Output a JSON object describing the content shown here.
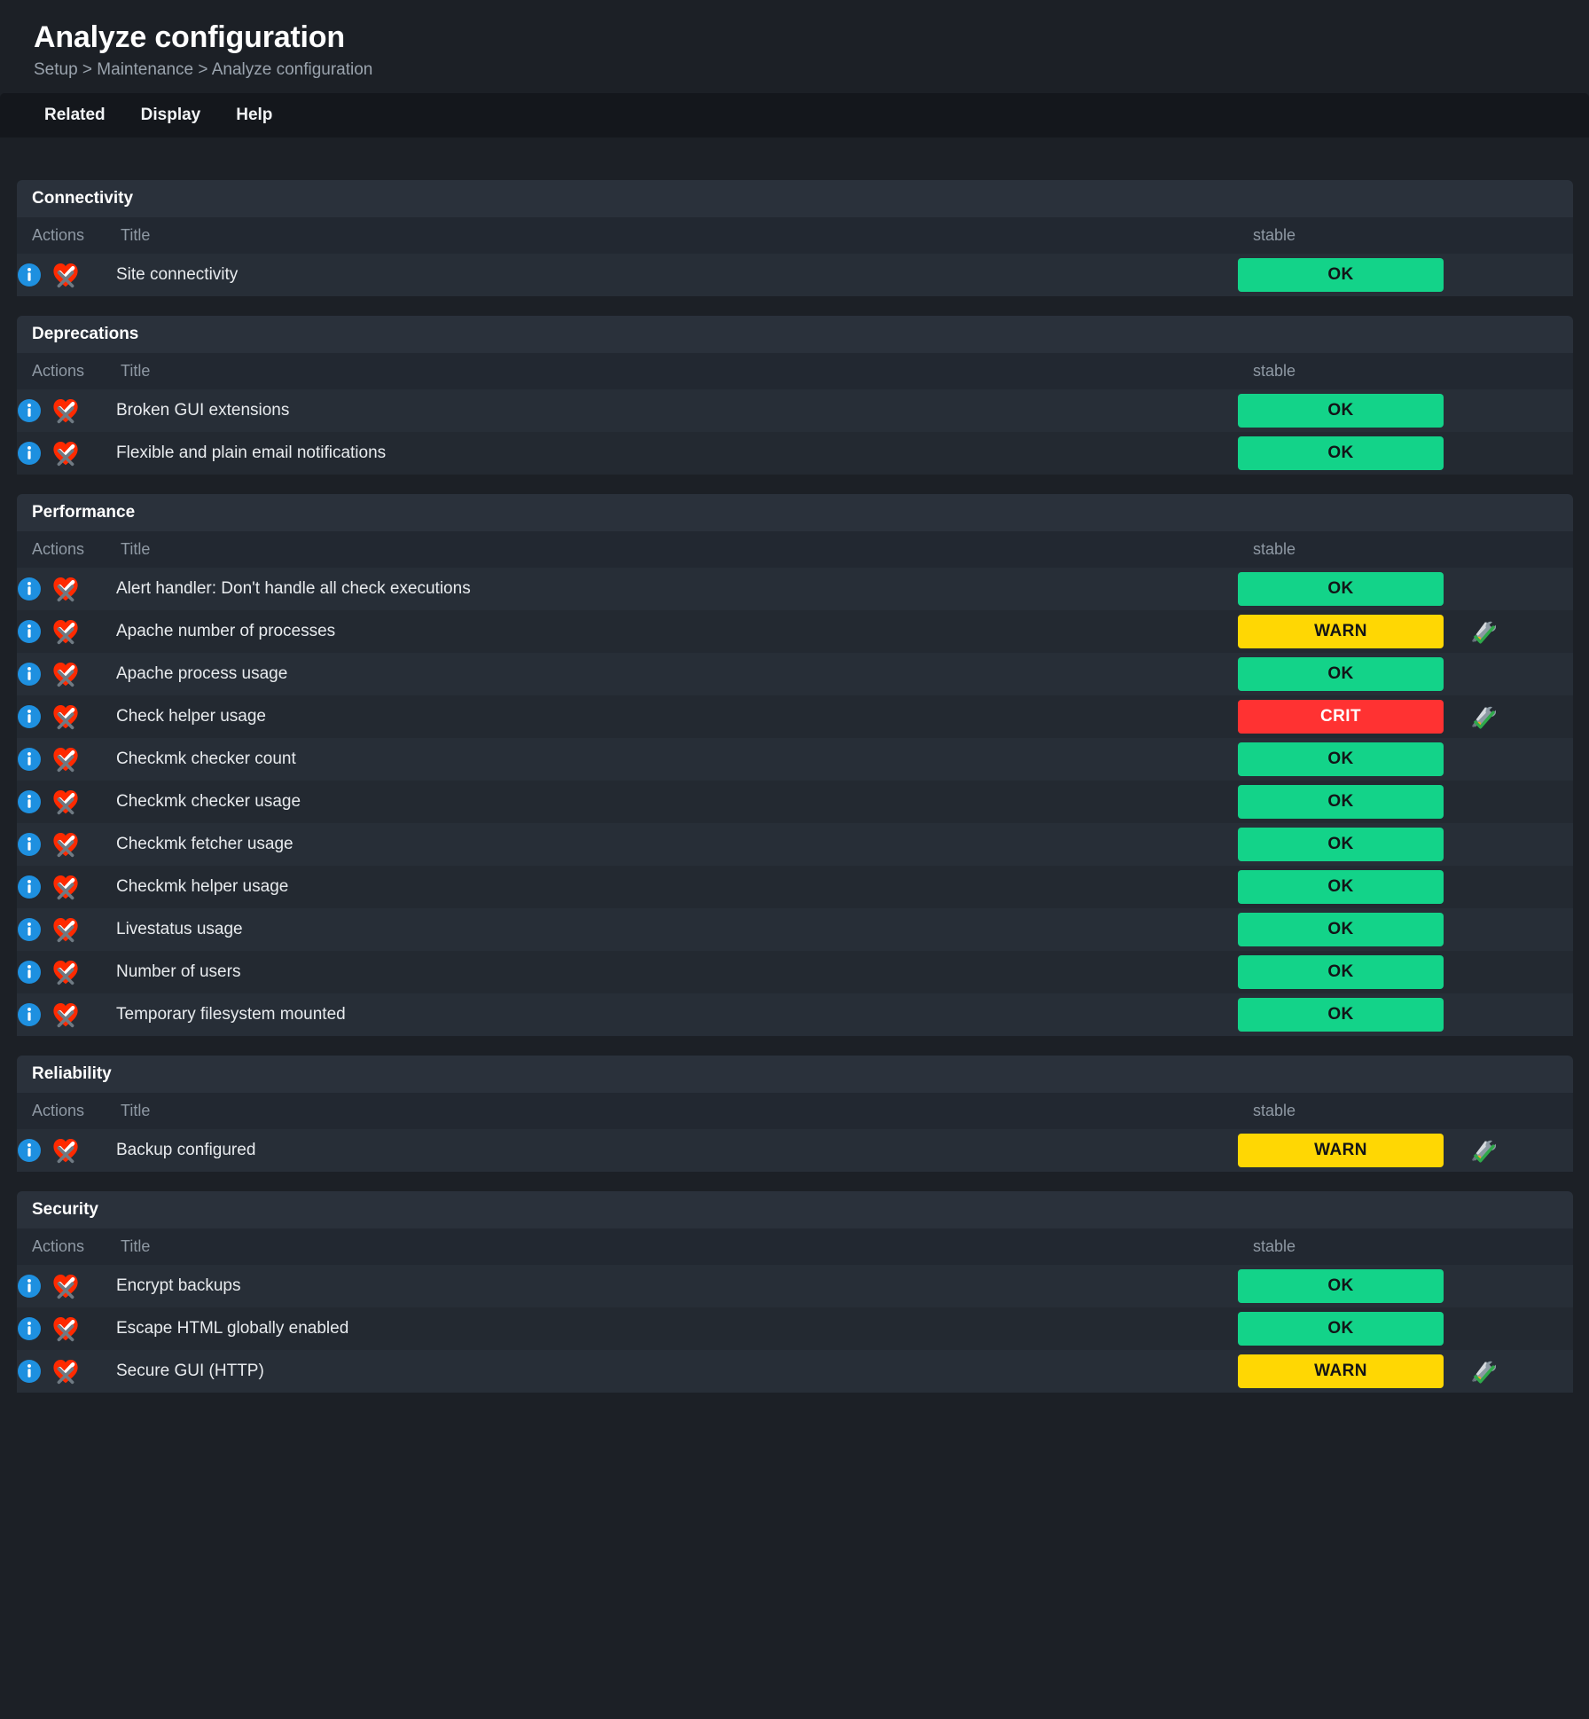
{
  "header": {
    "title": "Analyze configuration",
    "breadcrumb": "Setup > Maintenance > Analyze configuration"
  },
  "menu": {
    "items": [
      {
        "label": "Related"
      },
      {
        "label": "Display"
      },
      {
        "label": "Help"
      }
    ]
  },
  "columns": {
    "actions": "Actions",
    "title": "Title",
    "state": "stable"
  },
  "colors": {
    "ok": "#13d389",
    "warn": "#ffd703",
    "crit": "#ff3232",
    "page_bg": "#1c2026",
    "section_header_bg": "#2a313b",
    "row_bg": "#272e37",
    "row_alt_bg": "#232931",
    "menu_bg": "#14171c",
    "info_icon": "#1e90e0",
    "cmk_logo": "#ff2a00",
    "disable_x": "#6f7a83"
  },
  "icons": {
    "info": "info-icon",
    "disable_test": "checkmk-disable-test-icon",
    "rule": "wrench-rule-icon"
  },
  "sections": [
    {
      "name": "Connectivity",
      "rows": [
        {
          "title": "Site connectivity",
          "state": "OK",
          "state_class": "state-ok",
          "has_rule_icon": false
        }
      ]
    },
    {
      "name": "Deprecations",
      "rows": [
        {
          "title": "Broken GUI extensions",
          "state": "OK",
          "state_class": "state-ok",
          "has_rule_icon": false
        },
        {
          "title": "Flexible and plain email notifications",
          "state": "OK",
          "state_class": "state-ok",
          "has_rule_icon": false
        }
      ]
    },
    {
      "name": "Performance",
      "rows": [
        {
          "title": "Alert handler: Don't handle all check executions",
          "state": "OK",
          "state_class": "state-ok",
          "has_rule_icon": false
        },
        {
          "title": "Apache number of processes",
          "state": "WARN",
          "state_class": "state-warn",
          "has_rule_icon": true
        },
        {
          "title": "Apache process usage",
          "state": "OK",
          "state_class": "state-ok",
          "has_rule_icon": false
        },
        {
          "title": "Check helper usage",
          "state": "CRIT",
          "state_class": "state-crit",
          "has_rule_icon": true
        },
        {
          "title": "Checkmk checker count",
          "state": "OK",
          "state_class": "state-ok",
          "has_rule_icon": false
        },
        {
          "title": "Checkmk checker usage",
          "state": "OK",
          "state_class": "state-ok",
          "has_rule_icon": false
        },
        {
          "title": "Checkmk fetcher usage",
          "state": "OK",
          "state_class": "state-ok",
          "has_rule_icon": false
        },
        {
          "title": "Checkmk helper usage",
          "state": "OK",
          "state_class": "state-ok",
          "has_rule_icon": false
        },
        {
          "title": "Livestatus usage",
          "state": "OK",
          "state_class": "state-ok",
          "has_rule_icon": false
        },
        {
          "title": "Number of users",
          "state": "OK",
          "state_class": "state-ok",
          "has_rule_icon": false
        },
        {
          "title": "Temporary filesystem mounted",
          "state": "OK",
          "state_class": "state-ok",
          "has_rule_icon": false
        }
      ]
    },
    {
      "name": "Reliability",
      "rows": [
        {
          "title": "Backup configured",
          "state": "WARN",
          "state_class": "state-warn",
          "has_rule_icon": true
        }
      ]
    },
    {
      "name": "Security",
      "rows": [
        {
          "title": "Encrypt backups",
          "state": "OK",
          "state_class": "state-ok",
          "has_rule_icon": false
        },
        {
          "title": "Escape HTML globally enabled",
          "state": "OK",
          "state_class": "state-ok",
          "has_rule_icon": false
        },
        {
          "title": "Secure GUI (HTTP)",
          "state": "WARN",
          "state_class": "state-warn",
          "has_rule_icon": true
        }
      ]
    }
  ]
}
